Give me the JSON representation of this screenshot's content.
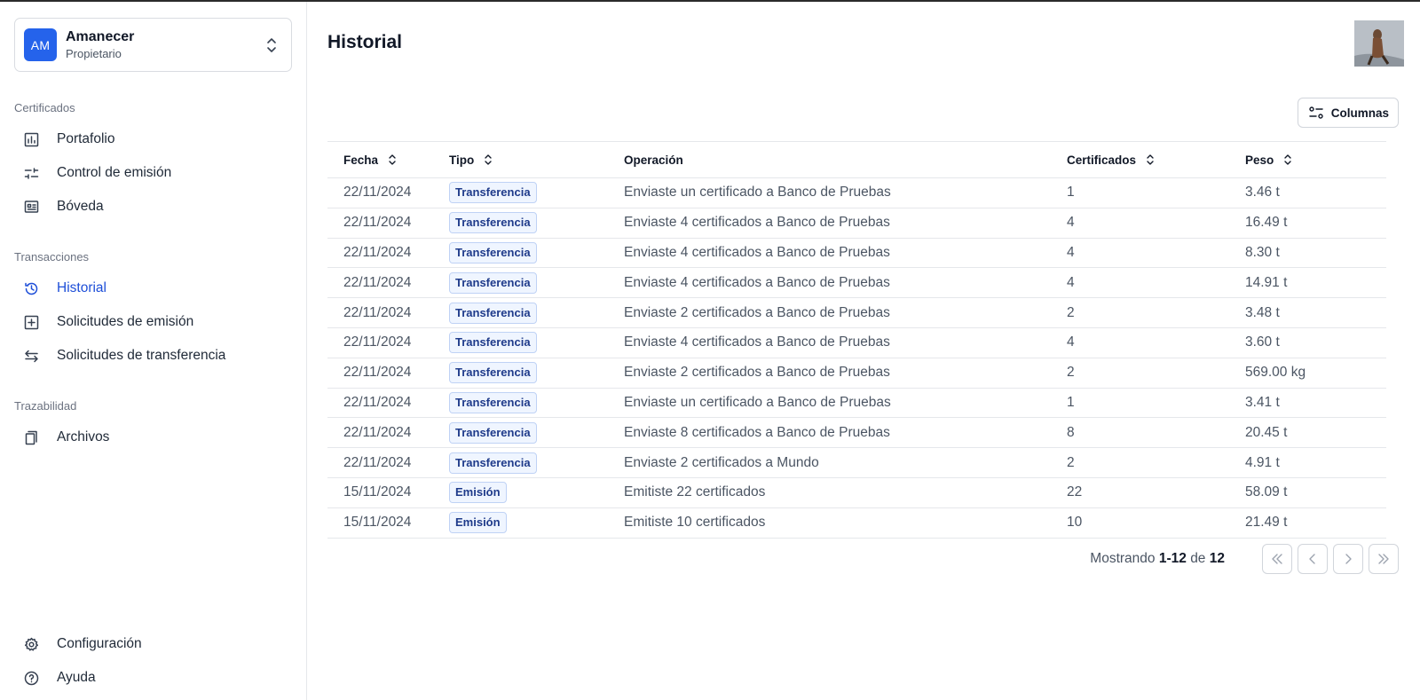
{
  "org": {
    "initials": "AM",
    "name": "Amanecer",
    "role": "Propietario"
  },
  "sidebar": {
    "sections": [
      {
        "title": "Certificados",
        "items": [
          {
            "label": "Portafolio",
            "icon": "bar-chart-icon"
          },
          {
            "label": "Control de emisión",
            "icon": "sliders-icon"
          },
          {
            "label": "Bóveda",
            "icon": "vault-icon"
          }
        ]
      },
      {
        "title": "Transacciones",
        "items": [
          {
            "label": "Historial",
            "icon": "history-icon",
            "active": true
          },
          {
            "label": "Solicitudes de emisión",
            "icon": "plus-square-icon"
          },
          {
            "label": "Solicitudes de transferencia",
            "icon": "arrows-left-right-icon"
          }
        ]
      },
      {
        "title": "Trazabilidad",
        "items": [
          {
            "label": "Archivos",
            "icon": "files-icon"
          }
        ]
      }
    ],
    "bottom": [
      {
        "label": "Configuración",
        "icon": "gear-icon"
      },
      {
        "label": "Ayuda",
        "icon": "help-circle-icon"
      }
    ]
  },
  "page": {
    "title": "Historial"
  },
  "toolbar": {
    "columns_label": "Columnas"
  },
  "table": {
    "headers": {
      "fecha": "Fecha",
      "tipo": "Tipo",
      "operacion": "Operación",
      "certificados": "Certificados",
      "peso": "Peso"
    },
    "rows": [
      {
        "fecha": "22/11/2024",
        "tipo": "Transferencia",
        "operacion": "Enviaste un certificado a Banco de Pruebas",
        "certificados": "1",
        "peso": "3.46 t"
      },
      {
        "fecha": "22/11/2024",
        "tipo": "Transferencia",
        "operacion": "Enviaste 4 certificados a Banco de Pruebas",
        "certificados": "4",
        "peso": "16.49 t"
      },
      {
        "fecha": "22/11/2024",
        "tipo": "Transferencia",
        "operacion": "Enviaste 4 certificados a Banco de Pruebas",
        "certificados": "4",
        "peso": "8.30 t"
      },
      {
        "fecha": "22/11/2024",
        "tipo": "Transferencia",
        "operacion": "Enviaste 4 certificados a Banco de Pruebas",
        "certificados": "4",
        "peso": "14.91 t"
      },
      {
        "fecha": "22/11/2024",
        "tipo": "Transferencia",
        "operacion": "Enviaste 2 certificados a Banco de Pruebas",
        "certificados": "2",
        "peso": "3.48 t"
      },
      {
        "fecha": "22/11/2024",
        "tipo": "Transferencia",
        "operacion": "Enviaste 4 certificados a Banco de Pruebas",
        "certificados": "4",
        "peso": "3.60 t"
      },
      {
        "fecha": "22/11/2024",
        "tipo": "Transferencia",
        "operacion": "Enviaste 2 certificados a Banco de Pruebas",
        "certificados": "2",
        "peso": "569.00 kg"
      },
      {
        "fecha": "22/11/2024",
        "tipo": "Transferencia",
        "operacion": "Enviaste un certificado a Banco de Pruebas",
        "certificados": "1",
        "peso": "3.41 t"
      },
      {
        "fecha": "22/11/2024",
        "tipo": "Transferencia",
        "operacion": "Enviaste 8 certificados a Banco de Pruebas",
        "certificados": "8",
        "peso": "20.45 t"
      },
      {
        "fecha": "22/11/2024",
        "tipo": "Transferencia",
        "operacion": "Enviaste 2 certificados a Mundo",
        "certificados": "2",
        "peso": "4.91 t"
      },
      {
        "fecha": "15/11/2024",
        "tipo": "Emisión",
        "operacion": "Emitiste 22 certificados",
        "certificados": "22",
        "peso": "58.09 t"
      },
      {
        "fecha": "15/11/2024",
        "tipo": "Emisión",
        "operacion": "Emitiste 10 certificados",
        "certificados": "10",
        "peso": "21.49 t"
      }
    ]
  },
  "pagination": {
    "prefix": "Mostrando",
    "range": "1-12",
    "of": "de",
    "total": "12"
  },
  "colors": {
    "accent": "#1d4ed8",
    "avatar_bg": "#2563eb",
    "badge_bg": "#eff5ff",
    "badge_border": "#bfd2f5",
    "badge_text": "#1e3a8a"
  }
}
